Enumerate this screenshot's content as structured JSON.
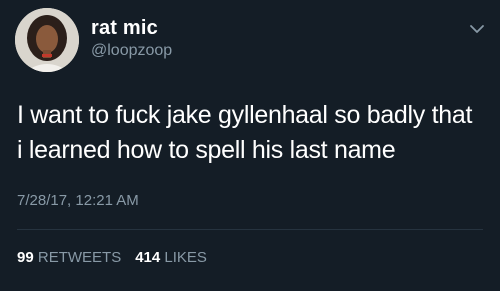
{
  "tweet": {
    "display_name": "rat mic",
    "handle": "@loopzoop",
    "text_lines": [
      "I want to fuck jake gyllenhaal so badly that",
      "i learned how to spell his last name"
    ],
    "timestamp": "7/28/17, 12:21 AM",
    "retweets_count": "99",
    "retweets_label": "RETWEETS",
    "likes_count": "414",
    "likes_label": "LIKES"
  },
  "icons": {
    "menu": "chevron-down-icon",
    "avatar": "avatar"
  },
  "colors": {
    "background": "#141d26",
    "primary_text": "#ffffff",
    "secondary_text": "#8899a6",
    "divider": "#26333f"
  }
}
